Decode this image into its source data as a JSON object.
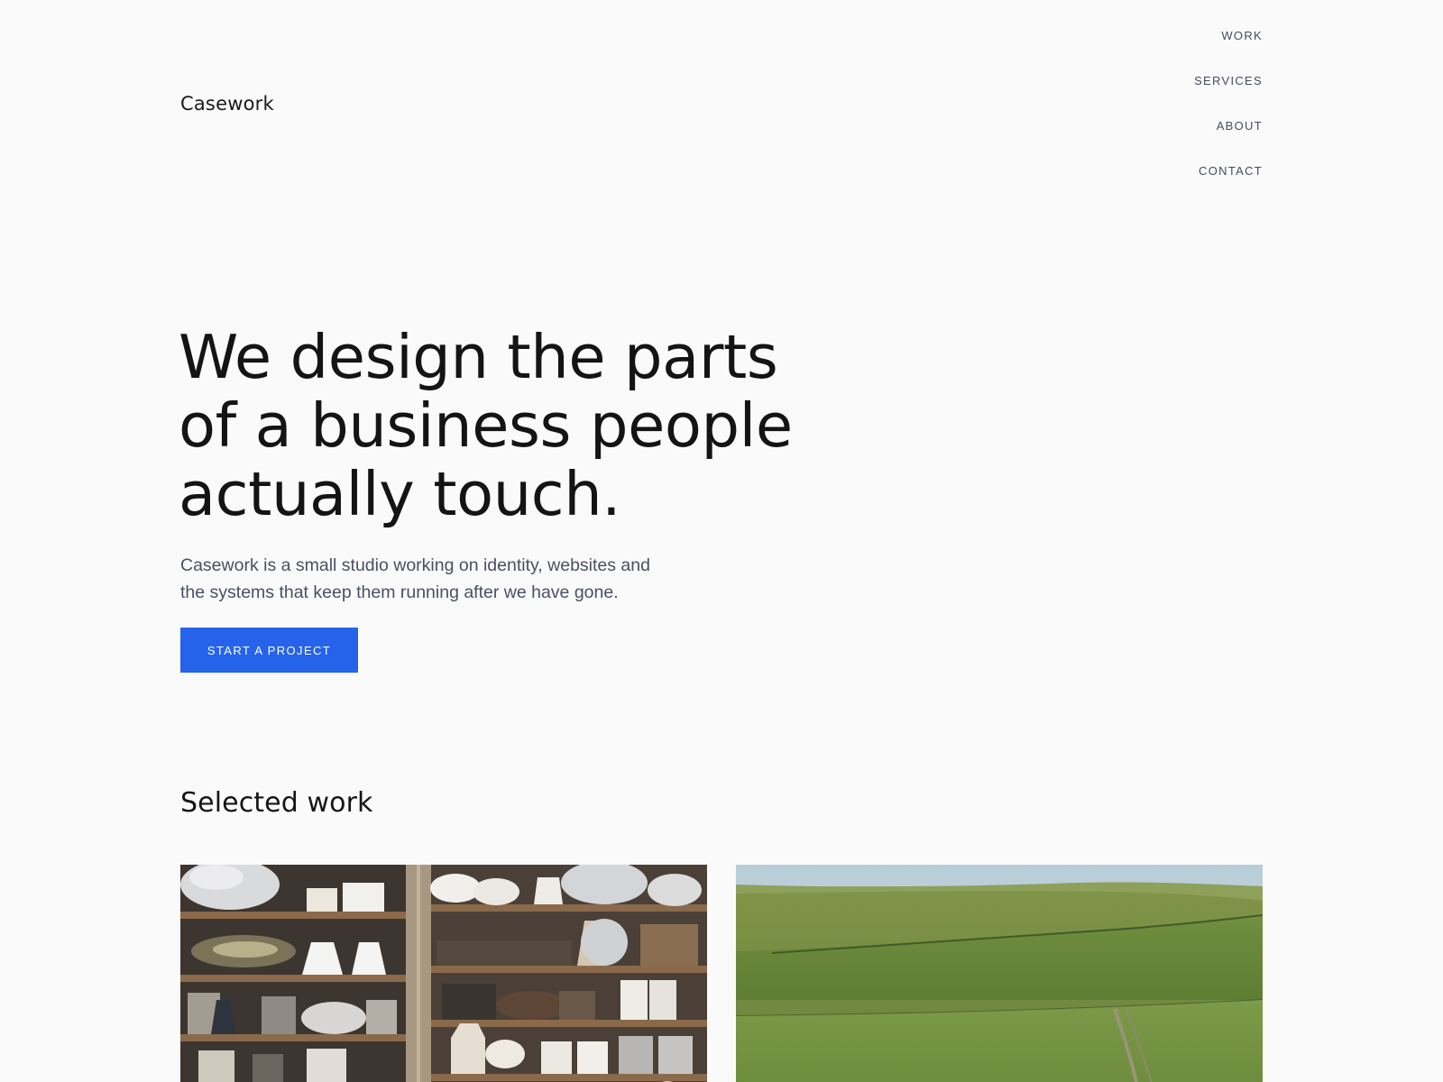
{
  "header": {
    "brand": "Casework",
    "nav": [
      "WORK",
      "SERVICES",
      "ABOUT",
      "CONTACT"
    ]
  },
  "hero": {
    "title_lines": [
      "We design the parts",
      "of a business people",
      "actually touch."
    ],
    "lede_lines": [
      "Casework is a small studio working on identity, websites and",
      "the systems that keep them running after we have gone."
    ],
    "cta_label": "START A PROJECT"
  },
  "work": {
    "heading": "Selected work",
    "items": [
      {
        "image": "ceramics-shelves-photo"
      },
      {
        "image": "green-hills-landscape-photo"
      }
    ]
  },
  "colors": {
    "background": "#fafafa",
    "accent": "#2563eb",
    "text": "#161616",
    "muted_text": "#4a5064"
  }
}
